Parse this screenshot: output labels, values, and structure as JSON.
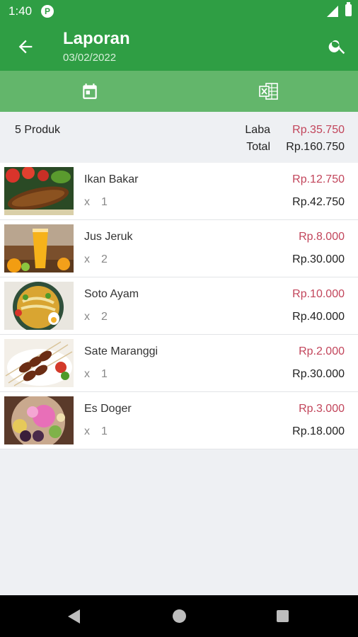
{
  "status_bar": {
    "time": "1:40",
    "notification_icon": "P"
  },
  "app_bar": {
    "title": "Laporan",
    "subtitle": "03/02/2022",
    "back_icon": "arrow-left-icon",
    "search_icon": "search-icon"
  },
  "tabs": [
    {
      "icon": "calendar-icon"
    },
    {
      "icon": "excel-export-icon"
    }
  ],
  "summary": {
    "product_count": "5 Produk",
    "laba_label": "Laba",
    "laba_value": "Rp.35.750",
    "total_label": "Total",
    "total_value": "Rp.160.750"
  },
  "items": [
    {
      "name": "Ikan Bakar",
      "qty_prefix": "x",
      "qty": "1",
      "profit": "Rp.12.750",
      "subtotal": "Rp.42.750"
    },
    {
      "name": "Jus Jeruk",
      "qty_prefix": "x",
      "qty": "2",
      "profit": "Rp.8.000",
      "subtotal": "Rp.30.000"
    },
    {
      "name": "Soto Ayam",
      "qty_prefix": "x",
      "qty": "2",
      "profit": "Rp.10.000",
      "subtotal": "Rp.40.000"
    },
    {
      "name": "Sate Maranggi",
      "qty_prefix": "x",
      "qty": "1",
      "profit": "Rp.2.000",
      "subtotal": "Rp.30.000"
    },
    {
      "name": "Es Doger",
      "qty_prefix": "x",
      "qty": "1",
      "profit": "Rp.3.000",
      "subtotal": "Rp.18.000"
    }
  ],
  "colors": {
    "primary": "#2f9e44",
    "tab_bar": "#63b66b",
    "profit": "#c2455b",
    "background": "#eef0f3"
  }
}
